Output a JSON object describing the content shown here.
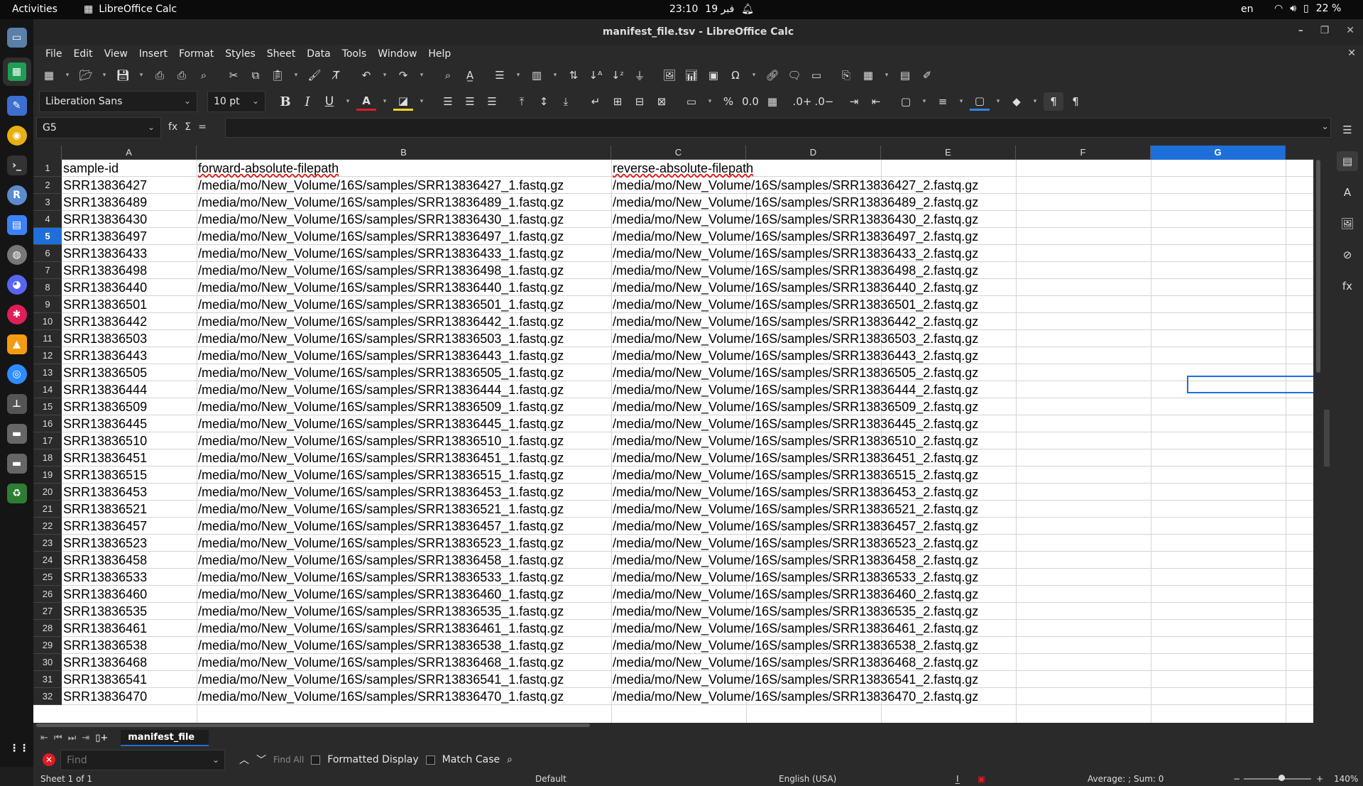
{
  "topbar": {
    "activities": "Activities",
    "app": "LibreOffice Calc",
    "time": "23:10",
    "date": "19 فبر",
    "lang": "en",
    "battery": "22 %"
  },
  "window": {
    "title": "manifest_file.tsv - LibreOffice Calc"
  },
  "menubar": {
    "items": [
      "File",
      "Edit",
      "View",
      "Insert",
      "Format",
      "Styles",
      "Sheet",
      "Data",
      "Tools",
      "Window",
      "Help"
    ]
  },
  "formatting": {
    "font_name": "Liberation Sans",
    "font_size": "10 pt"
  },
  "formula_bar": {
    "cell_ref": "G5",
    "fx": "fx",
    "sum": "Σ",
    "equals": "=",
    "content": ""
  },
  "sheet": {
    "columns": [
      "A",
      "B",
      "C",
      "D",
      "E",
      "F",
      "G"
    ],
    "selected_column": "G",
    "selected_row": 5,
    "rows": [
      {
        "n": "1",
        "a": "sample-id",
        "b": "forward-absolute-filepath",
        "c": "reverse-absolute-filepath"
      },
      {
        "n": "2",
        "a": "SRR13836427",
        "b": "/media/mo/New_Volume/16S/samples/SRR13836427_1.fastq.gz",
        "c": "/media/mo/New_Volume/16S/samples/SRR13836427_2.fastq.gz"
      },
      {
        "n": "3",
        "a": "SRR13836489",
        "b": "/media/mo/New_Volume/16S/samples/SRR13836489_1.fastq.gz",
        "c": "/media/mo/New_Volume/16S/samples/SRR13836489_2.fastq.gz"
      },
      {
        "n": "4",
        "a": "SRR13836430",
        "b": "/media/mo/New_Volume/16S/samples/SRR13836430_1.fastq.gz",
        "c": "/media/mo/New_Volume/16S/samples/SRR13836430_2.fastq.gz"
      },
      {
        "n": "5",
        "a": "SRR13836497",
        "b": "/media/mo/New_Volume/16S/samples/SRR13836497_1.fastq.gz",
        "c": "/media/mo/New_Volume/16S/samples/SRR13836497_2.fastq.gz"
      },
      {
        "n": "6",
        "a": "SRR13836433",
        "b": "/media/mo/New_Volume/16S/samples/SRR13836433_1.fastq.gz",
        "c": "/media/mo/New_Volume/16S/samples/SRR13836433_2.fastq.gz"
      },
      {
        "n": "7",
        "a": "SRR13836498",
        "b": "/media/mo/New_Volume/16S/samples/SRR13836498_1.fastq.gz",
        "c": "/media/mo/New_Volume/16S/samples/SRR13836498_2.fastq.gz"
      },
      {
        "n": "8",
        "a": "SRR13836440",
        "b": "/media/mo/New_Volume/16S/samples/SRR13836440_1.fastq.gz",
        "c": "/media/mo/New_Volume/16S/samples/SRR13836440_2.fastq.gz"
      },
      {
        "n": "9",
        "a": "SRR13836501",
        "b": "/media/mo/New_Volume/16S/samples/SRR13836501_1.fastq.gz",
        "c": "/media/mo/New_Volume/16S/samples/SRR13836501_2.fastq.gz"
      },
      {
        "n": "10",
        "a": "SRR13836442",
        "b": "/media/mo/New_Volume/16S/samples/SRR13836442_1.fastq.gz",
        "c": "/media/mo/New_Volume/16S/samples/SRR13836442_2.fastq.gz"
      },
      {
        "n": "11",
        "a": "SRR13836503",
        "b": "/media/mo/New_Volume/16S/samples/SRR13836503_1.fastq.gz",
        "c": "/media/mo/New_Volume/16S/samples/SRR13836503_2.fastq.gz"
      },
      {
        "n": "12",
        "a": "SRR13836443",
        "b": "/media/mo/New_Volume/16S/samples/SRR13836443_1.fastq.gz",
        "c": "/media/mo/New_Volume/16S/samples/SRR13836443_2.fastq.gz"
      },
      {
        "n": "13",
        "a": "SRR13836505",
        "b": "/media/mo/New_Volume/16S/samples/SRR13836505_1.fastq.gz",
        "c": "/media/mo/New_Volume/16S/samples/SRR13836505_2.fastq.gz"
      },
      {
        "n": "14",
        "a": "SRR13836444",
        "b": "/media/mo/New_Volume/16S/samples/SRR13836444_1.fastq.gz",
        "c": "/media/mo/New_Volume/16S/samples/SRR13836444_2.fastq.gz"
      },
      {
        "n": "15",
        "a": "SRR13836509",
        "b": "/media/mo/New_Volume/16S/samples/SRR13836509_1.fastq.gz",
        "c": "/media/mo/New_Volume/16S/samples/SRR13836509_2.fastq.gz"
      },
      {
        "n": "16",
        "a": "SRR13836445",
        "b": "/media/mo/New_Volume/16S/samples/SRR13836445_1.fastq.gz",
        "c": "/media/mo/New_Volume/16S/samples/SRR13836445_2.fastq.gz"
      },
      {
        "n": "17",
        "a": "SRR13836510",
        "b": "/media/mo/New_Volume/16S/samples/SRR13836510_1.fastq.gz",
        "c": "/media/mo/New_Volume/16S/samples/SRR13836510_2.fastq.gz"
      },
      {
        "n": "18",
        "a": "SRR13836451",
        "b": "/media/mo/New_Volume/16S/samples/SRR13836451_1.fastq.gz",
        "c": "/media/mo/New_Volume/16S/samples/SRR13836451_2.fastq.gz"
      },
      {
        "n": "19",
        "a": "SRR13836515",
        "b": "/media/mo/New_Volume/16S/samples/SRR13836515_1.fastq.gz",
        "c": "/media/mo/New_Volume/16S/samples/SRR13836515_2.fastq.gz"
      },
      {
        "n": "20",
        "a": "SRR13836453",
        "b": "/media/mo/New_Volume/16S/samples/SRR13836453_1.fastq.gz",
        "c": "/media/mo/New_Volume/16S/samples/SRR13836453_2.fastq.gz"
      },
      {
        "n": "21",
        "a": "SRR13836521",
        "b": "/media/mo/New_Volume/16S/samples/SRR13836521_1.fastq.gz",
        "c": "/media/mo/New_Volume/16S/samples/SRR13836521_2.fastq.gz"
      },
      {
        "n": "22",
        "a": "SRR13836457",
        "b": "/media/mo/New_Volume/16S/samples/SRR13836457_1.fastq.gz",
        "c": "/media/mo/New_Volume/16S/samples/SRR13836457_2.fastq.gz"
      },
      {
        "n": "23",
        "a": "SRR13836523",
        "b": "/media/mo/New_Volume/16S/samples/SRR13836523_1.fastq.gz",
        "c": "/media/mo/New_Volume/16S/samples/SRR13836523_2.fastq.gz"
      },
      {
        "n": "24",
        "a": "SRR13836458",
        "b": "/media/mo/New_Volume/16S/samples/SRR13836458_1.fastq.gz",
        "c": "/media/mo/New_Volume/16S/samples/SRR13836458_2.fastq.gz"
      },
      {
        "n": "25",
        "a": "SRR13836533",
        "b": "/media/mo/New_Volume/16S/samples/SRR13836533_1.fastq.gz",
        "c": "/media/mo/New_Volume/16S/samples/SRR13836533_2.fastq.gz"
      },
      {
        "n": "26",
        "a": "SRR13836460",
        "b": "/media/mo/New_Volume/16S/samples/SRR13836460_1.fastq.gz",
        "c": "/media/mo/New_Volume/16S/samples/SRR13836460_2.fastq.gz"
      },
      {
        "n": "27",
        "a": "SRR13836535",
        "b": "/media/mo/New_Volume/16S/samples/SRR13836535_1.fastq.gz",
        "c": "/media/mo/New_Volume/16S/samples/SRR13836535_2.fastq.gz"
      },
      {
        "n": "28",
        "a": "SRR13836461",
        "b": "/media/mo/New_Volume/16S/samples/SRR13836461_1.fastq.gz",
        "c": "/media/mo/New_Volume/16S/samples/SRR13836461_2.fastq.gz"
      },
      {
        "n": "29",
        "a": "SRR13836538",
        "b": "/media/mo/New_Volume/16S/samples/SRR13836538_1.fastq.gz",
        "c": "/media/mo/New_Volume/16S/samples/SRR13836538_2.fastq.gz"
      },
      {
        "n": "30",
        "a": "SRR13836468",
        "b": "/media/mo/New_Volume/16S/samples/SRR13836468_1.fastq.gz",
        "c": "/media/mo/New_Volume/16S/samples/SRR13836468_2.fastq.gz"
      },
      {
        "n": "31",
        "a": "SRR13836541",
        "b": "/media/mo/New_Volume/16S/samples/SRR13836541_1.fastq.gz",
        "c": "/media/mo/New_Volume/16S/samples/SRR13836541_2.fastq.gz"
      },
      {
        "n": "32",
        "a": "SRR13836470",
        "b": "/media/mo/New_Volume/16S/samples/SRR13836470_1.fastq.gz",
        "c": "/media/mo/New_Volume/16S/samples/SRR13836470_2.fastq.gz"
      }
    ]
  },
  "tabs": {
    "sheet_name": "manifest_file"
  },
  "findbar": {
    "placeholder": "Find",
    "find_all": "Find All",
    "formatted_display": "Formatted Display",
    "match_case": "Match Case"
  },
  "statusbar": {
    "sheet_info": "Sheet 1 of 1",
    "page_style": "Default",
    "language": "English (USA)",
    "summary": "Average: ; Sum: 0",
    "zoom": "140%"
  },
  "colors": {
    "accent": "#1e6fd9",
    "background": "#2a2a2a",
    "sheet": "#ffffff"
  }
}
